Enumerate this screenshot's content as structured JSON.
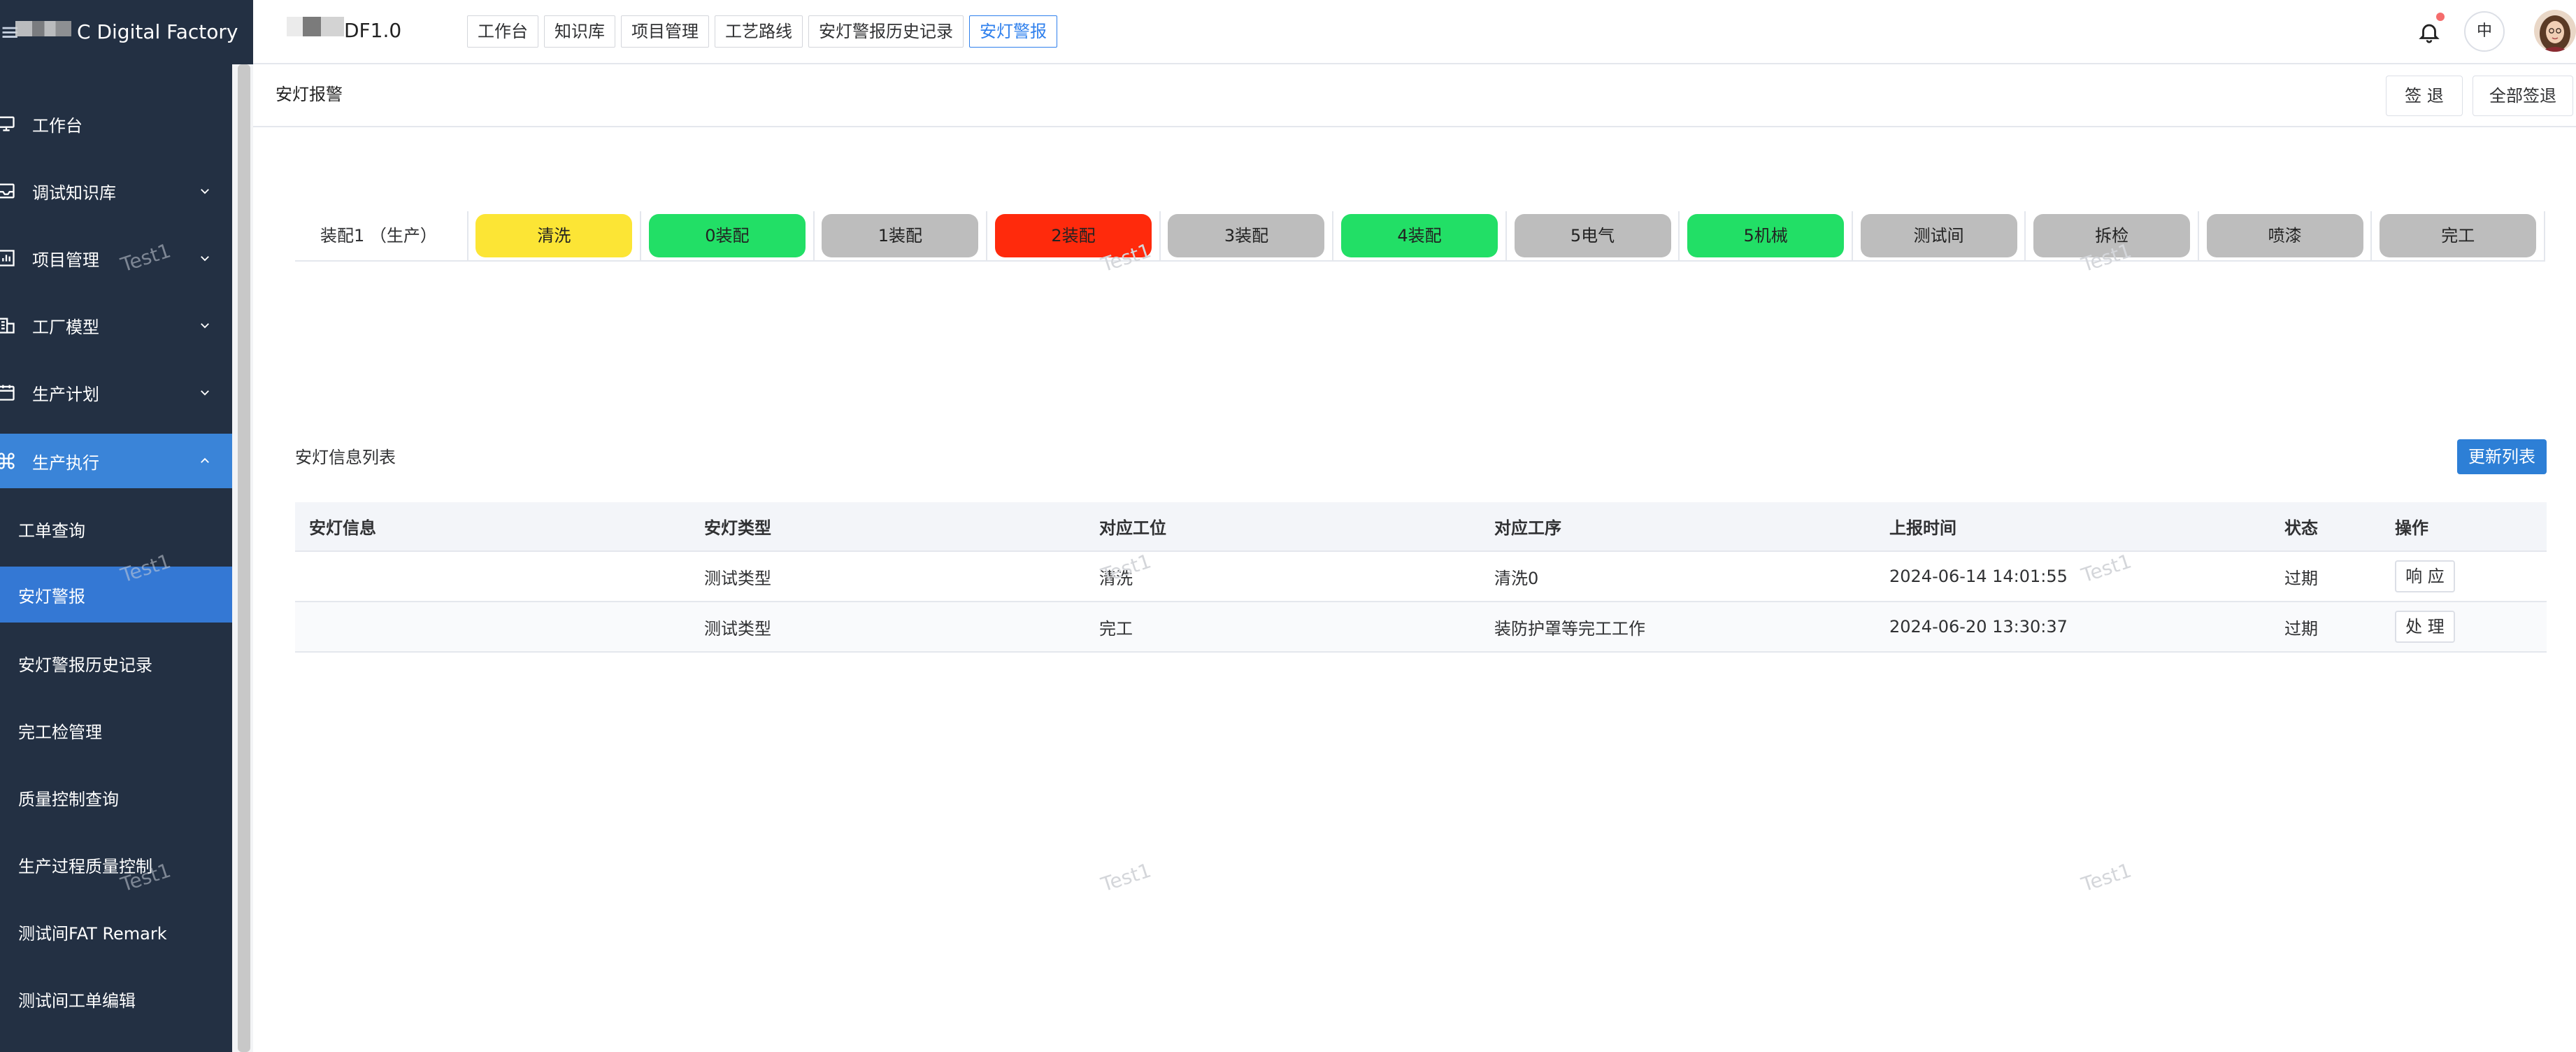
{
  "sidebar": {
    "brand": "C Digital Factory",
    "items": [
      {
        "label": "工作台",
        "icon": "monitor-icon",
        "has_children": false
      },
      {
        "label": "调试知识库",
        "icon": "inbox-icon",
        "has_children": true
      },
      {
        "label": "项目管理",
        "icon": "chart-icon",
        "has_children": true
      },
      {
        "label": "工厂模型",
        "icon": "building-icon",
        "has_children": true
      },
      {
        "label": "生产计划",
        "icon": "calendar-icon",
        "has_children": true
      },
      {
        "label": "生产执行",
        "icon": "command-icon",
        "has_children": true,
        "expanded": true
      }
    ],
    "subitems": [
      {
        "label": "工单查询",
        "selected": false
      },
      {
        "label": "安灯警报",
        "selected": true
      },
      {
        "label": "安灯警报历史记录",
        "selected": false
      },
      {
        "label": "完工检管理",
        "selected": false
      },
      {
        "label": "质量控制查询",
        "selected": false
      },
      {
        "label": "生产过程质量控制",
        "selected": false
      },
      {
        "label": "测试间FAT Remark",
        "selected": false
      },
      {
        "label": "测试间工单编辑",
        "selected": false
      }
    ]
  },
  "topbar": {
    "app_title": "DF1.0",
    "tabs": [
      {
        "label": "工作台",
        "active": false
      },
      {
        "label": "知识库",
        "active": false
      },
      {
        "label": "项目管理",
        "active": false
      },
      {
        "label": "工艺路线",
        "active": false
      },
      {
        "label": "安灯警报历史记录",
        "active": false
      },
      {
        "label": "安灯警报",
        "active": true
      }
    ],
    "lang": "中",
    "notification_icon": "bell-icon",
    "notification_dot_color": "#f56c6c"
  },
  "page": {
    "title": "安灯报警",
    "sign_out_label": "签 退",
    "sign_out_all_label": "全部签退"
  },
  "stations": {
    "line_label": "装配1 （生产）",
    "items": [
      {
        "label": "清洗",
        "color": "#fce535"
      },
      {
        "label": "0装配",
        "color": "#22df66"
      },
      {
        "label": "1装配",
        "color": "#bdbdbd"
      },
      {
        "label": "2装配",
        "color": "#ff2a0c"
      },
      {
        "label": "3装配",
        "color": "#bdbdbd"
      },
      {
        "label": "4装配",
        "color": "#22df66"
      },
      {
        "label": "5电气",
        "color": "#bdbdbd"
      },
      {
        "label": "5机械",
        "color": "#22df66"
      },
      {
        "label": "测试间",
        "color": "#bdbdbd"
      },
      {
        "label": "拆检",
        "color": "#bdbdbd"
      },
      {
        "label": "喷漆",
        "color": "#bdbdbd"
      },
      {
        "label": "完工",
        "color": "#bdbdbd"
      }
    ]
  },
  "alarm_list": {
    "title": "安灯信息列表",
    "refresh_label": "更新列表",
    "columns": [
      "安灯信息",
      "安灯类型",
      "对应工位",
      "对应工序",
      "上报时间",
      "状态",
      "操作"
    ],
    "rows": [
      {
        "info": "",
        "type": "测试类型",
        "station": "清洗",
        "process": "清洗0",
        "time": "2024-06-14 14:01:55",
        "status": "过期",
        "action": "响 应"
      },
      {
        "info": "",
        "type": "测试类型",
        "station": "完工",
        "process": "装防护罩等完工工作",
        "time": "2024-06-20 13:30:37",
        "status": "过期",
        "action": "处 理"
      }
    ]
  },
  "watermark_text": "Test1",
  "colors": {
    "sidebar_bg": "#233043",
    "sidebar_active": "#3478d4",
    "accent": "#2f80ed",
    "status_overdue": "#f0231e"
  }
}
